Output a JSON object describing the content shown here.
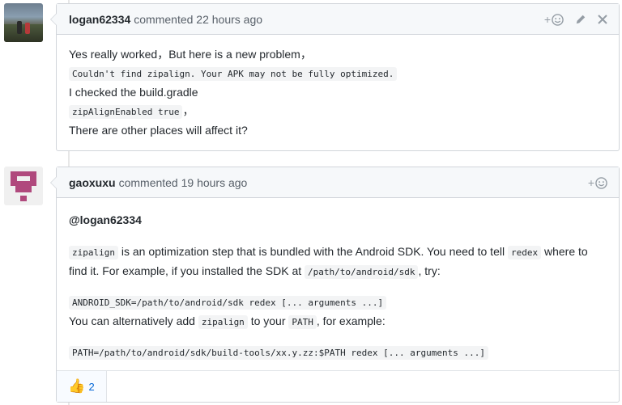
{
  "comments": [
    {
      "author": "logan62334",
      "action_text": "commented 22 hours ago",
      "lines": [
        {
          "type": "text",
          "text": "Yes really worked，But here is a new problem，"
        },
        {
          "type": "code",
          "text": "Couldn't find zipalign. Your APK may not be fully optimized."
        },
        {
          "type": "text",
          "text": "I checked the build.gradle"
        },
        {
          "type": "mixed",
          "code": "zipAlignEnabled true",
          "after": "，"
        },
        {
          "type": "text",
          "text": "There are other places will affect it?"
        }
      ],
      "actions": [
        "add-reaction-icon",
        "pencil-icon",
        "close-icon"
      ]
    },
    {
      "author": "gaoxuxu",
      "action_text": "commented 19 hours ago",
      "mention": "@logan62334",
      "para1": {
        "code1": "zipalign",
        "text1": " is an optimization step that is bundled with the Android SDK. You need to tell ",
        "code2": "redex",
        "text2": " where to find it. For example, if you installed the SDK at ",
        "code3": "/path/to/android/sdk",
        "text3": ", try:"
      },
      "pre1": "ANDROID_SDK=/path/to/android/sdk redex [... arguments ...]",
      "para2": {
        "text1": "You can alternatively add ",
        "code1": "zipalign",
        "text2": " to your ",
        "code2": "PATH",
        "text3": ", for example:"
      },
      "pre2": "PATH=/path/to/android/sdk/build-tools/xx.y.zz:$PATH redex [... arguments ...]",
      "reaction": {
        "icon": "thumbs-up-icon",
        "emoji": "👍",
        "count": "2"
      },
      "actions": [
        "add-reaction-icon"
      ]
    }
  ],
  "colors": {
    "link": "#0366d6",
    "header_bg": "#f6f8fa",
    "border": "#d1d5da",
    "avatar_identicon": "#b0497d"
  }
}
